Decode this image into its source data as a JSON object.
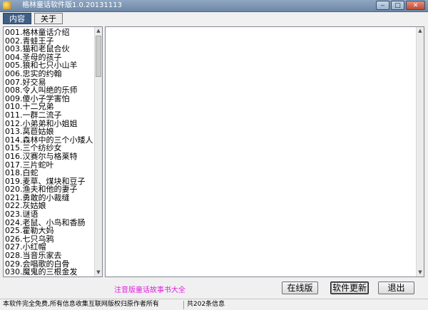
{
  "window": {
    "title": "格林童话软件版1.0.20131113",
    "buttons": {
      "minimize": "‒",
      "maximize": "□",
      "close": "✕"
    }
  },
  "tabs": [
    {
      "label": "内容",
      "active": true
    },
    {
      "label": "关于",
      "active": false
    }
  ],
  "story_list": [
    "001.格林童话介绍",
    "002.青蛙王子",
    "003.猫和老鼠合伙",
    "004.圣母的孩子",
    "005.狼和七只小山羊",
    "006.忠实的约翰",
    "007.好交易",
    "008.令人叫绝的乐师",
    "009.傻小子学害怕",
    "010.十二兄弟",
    "011.一群二流子",
    "012.小弟弟和小姐姐",
    "013.莴苣姑娘",
    "014.森林中的三个小矮人",
    "015.三个纺纱女",
    "016.汉赛尔与格莱特",
    "017.三片蛇叶",
    "018.白蛇",
    "019.麦草、煤块和豆子",
    "020.渔夫和他的妻子",
    "021.勇敢的小裁缝",
    "022.灰姑娘",
    "023.谜语",
    "024.老鼠、小鸟和香肠",
    "025.霍勒大妈",
    "026.七只乌鸦",
    "027.小红帽",
    "028.当音乐家去",
    "029.会唱歌的白骨",
    "030.魔鬼的三根金发"
  ],
  "footer": {
    "app_caption": "注音版童话故事书大全",
    "online_button": "在线版",
    "update_button": "软件更新",
    "exit_button": "退出"
  },
  "statusbar": {
    "left": "本软件完全免费,所有信息收集互联网版权归原作者所有",
    "right": "共202条信息"
  },
  "colors": {
    "caption": "#e020e0",
    "tab_active": "#3f5f86"
  }
}
